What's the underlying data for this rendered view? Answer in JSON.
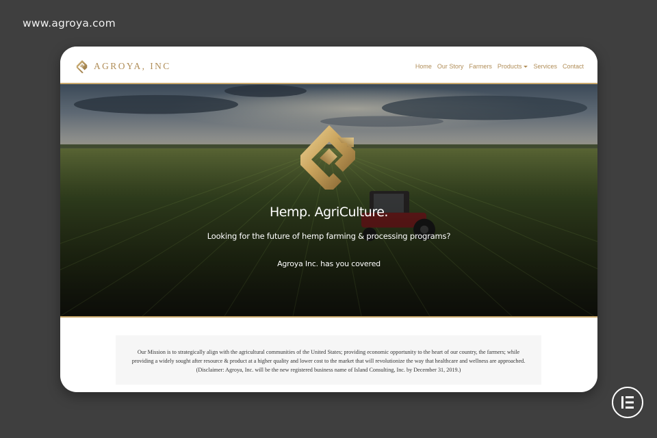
{
  "url_label": "www.agroya.com",
  "brand": {
    "name": "AGROYA, INC",
    "accent_color": "#b08d57"
  },
  "nav": {
    "items": [
      {
        "label": "Home"
      },
      {
        "label": "Our Story"
      },
      {
        "label": "Farmers"
      },
      {
        "label": "Products",
        "has_dropdown": true
      },
      {
        "label": "Services"
      },
      {
        "label": "Contact"
      }
    ]
  },
  "hero": {
    "title": "Hemp. AgriCulture.",
    "subtitle": "Looking for the future of hemp farming & processing programs?",
    "tagline": "Agroya Inc. has you covered",
    "logo_icon": "agroya-emblem-icon"
  },
  "mission": {
    "line1": "Our Mission is to strategically align with the agricultural communities of the United States; providing economic opportunity to the heart of our country, the farmers; while",
    "line2": "providing a widely sought after resource & product at a higher quality and lower cost to the market that will revolutionize the way that healthcare and wellness are approached.",
    "line3": "(Disclaimer: Agroya, Inc. will be the new registered business name of Island Consulting, Inc. by December 31, 2019.)"
  },
  "badge": {
    "icon": "elementor-logo-icon"
  },
  "colors": {
    "background": "#3f3f3f",
    "gold": "#b08d57",
    "card": "#ffffff"
  }
}
